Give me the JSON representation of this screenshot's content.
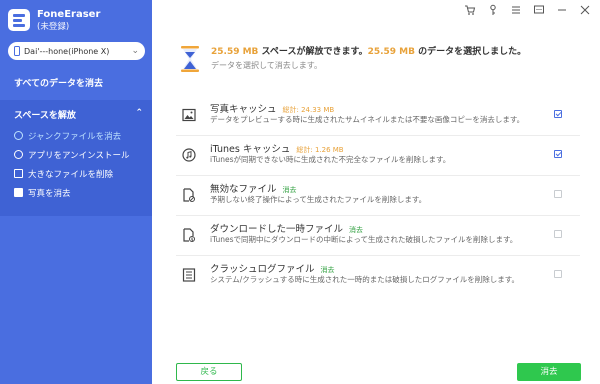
{
  "app": {
    "name": "FoneEraser",
    "status": "(未登録)"
  },
  "device": {
    "name": "Dai'---hone(iPhone X)"
  },
  "nav": {
    "all_data": "すべてのデータを消去",
    "group_title": "スペースを解放",
    "items": [
      {
        "label": "ジャンクファイルを消去",
        "icon": "clock-icon",
        "active": true
      },
      {
        "label": "アプリをアンインストール",
        "icon": "apps-icon",
        "active": false
      },
      {
        "label": "大きなファイルを削除",
        "icon": "file-icon",
        "active": false
      },
      {
        "label": "写真を消去",
        "icon": "photo-icon",
        "active": false
      }
    ]
  },
  "window_icons": [
    "cart-icon",
    "key-icon",
    "menu-icon",
    "feedback-icon",
    "minimize-icon",
    "close-icon"
  ],
  "summary": {
    "size_freed": "25.59 MB",
    "text_mid": " スペースが解放できます。",
    "size_selected": "25.59 MB",
    "text_end": " のデータを選択しました。",
    "subtitle": "データを選択して消去します。"
  },
  "items": [
    {
      "title": "写真キャッシュ",
      "badge": "総計: 24.33 MB",
      "badge_type": "size",
      "desc": "データをプレビューする時に生成されたサムイネイルまたは不要な画像コピーを消去します。",
      "checked": true,
      "icon": "image-icon"
    },
    {
      "title": "iTunes キャッシュ",
      "badge": "総計: 1.26 MB",
      "badge_type": "size",
      "desc": "iTunesが同期できない時に生成された不完全なファイルを削除します。",
      "checked": true,
      "icon": "music-icon"
    },
    {
      "title": "無効なファイル",
      "badge": "消去",
      "badge_type": "green",
      "desc": "予期しない終了操作によって生成されたファイルを削除します。",
      "checked": false,
      "icon": "invalid-file-icon"
    },
    {
      "title": "ダウンロードした一時ファイル",
      "badge": "消去",
      "badge_type": "green",
      "desc": "iTunesで同期中にダウンロードの中断によって生成された破損したファイルを削除します。",
      "checked": false,
      "icon": "download-file-icon"
    },
    {
      "title": "クラッシュログファイル",
      "badge": "消去",
      "badge_type": "green",
      "desc": "システム/クラッシュする時に生成された一時的または破損したログファイルを削除します。",
      "checked": false,
      "icon": "log-file-icon"
    }
  ],
  "footer": {
    "back": "戻る",
    "erase": "消去"
  },
  "colors": {
    "sidebar": "#4a6ee0",
    "accent_orange": "#e8a23a",
    "accent_green": "#2fc84e"
  }
}
